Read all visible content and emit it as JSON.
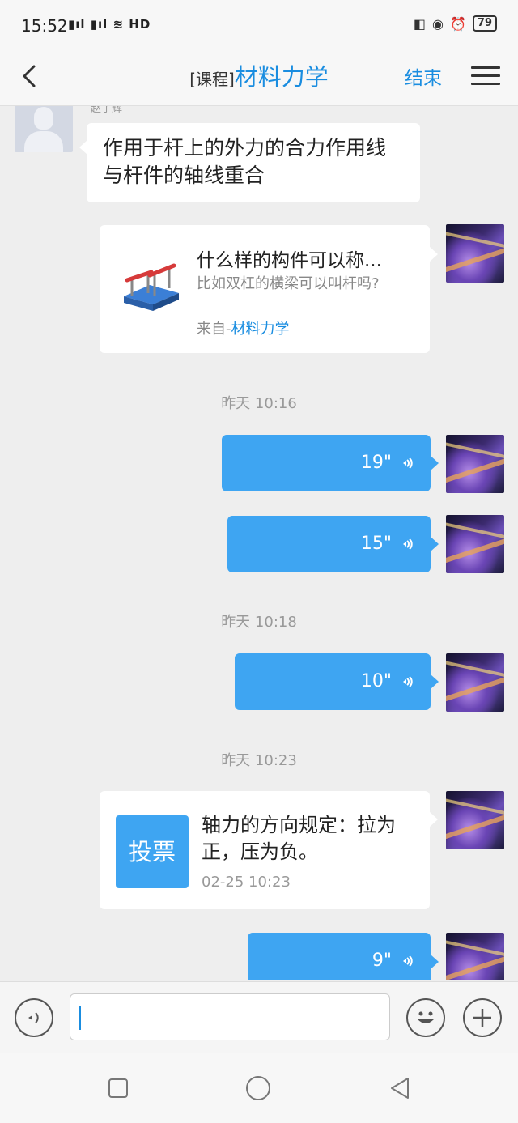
{
  "status_bar": {
    "time": "15:52",
    "signal": "ᵀıl ᵀıl",
    "battery": "79"
  },
  "header": {
    "title_prefix": "[课程]",
    "title": "材料力学",
    "end_label": "结束"
  },
  "messages": {
    "sender_name": "赵子辉",
    "text_message": "作用于杆上的外力的合力作用线与杆件的轴线重合",
    "card": {
      "title": "什么样的构件可以称...",
      "description": "比如双杠的横梁可以叫杆吗?",
      "source_prefix": "来自-",
      "source_link": "材料力学"
    },
    "time1": "昨天 10:16",
    "voice1": "19\"",
    "voice2": "15\"",
    "time2": "昨天 10:18",
    "voice3": "10\"",
    "time3": "昨天 10:23",
    "vote": {
      "icon_label": "投票",
      "text": "轴力的方向规定：拉为正，压为负。",
      "time": "02-25 10:23"
    },
    "voice4": "9\""
  },
  "colors": {
    "accent": "#1a8de0",
    "voice_bubble": "#3ea5f2",
    "background": "#eeeeee"
  },
  "icons": {
    "back": "chevron-left-icon",
    "menu": "hamburger-menu-icon",
    "voice_toggle": "voice-icon",
    "emoji": "smiley-icon",
    "plus": "plus-icon"
  }
}
